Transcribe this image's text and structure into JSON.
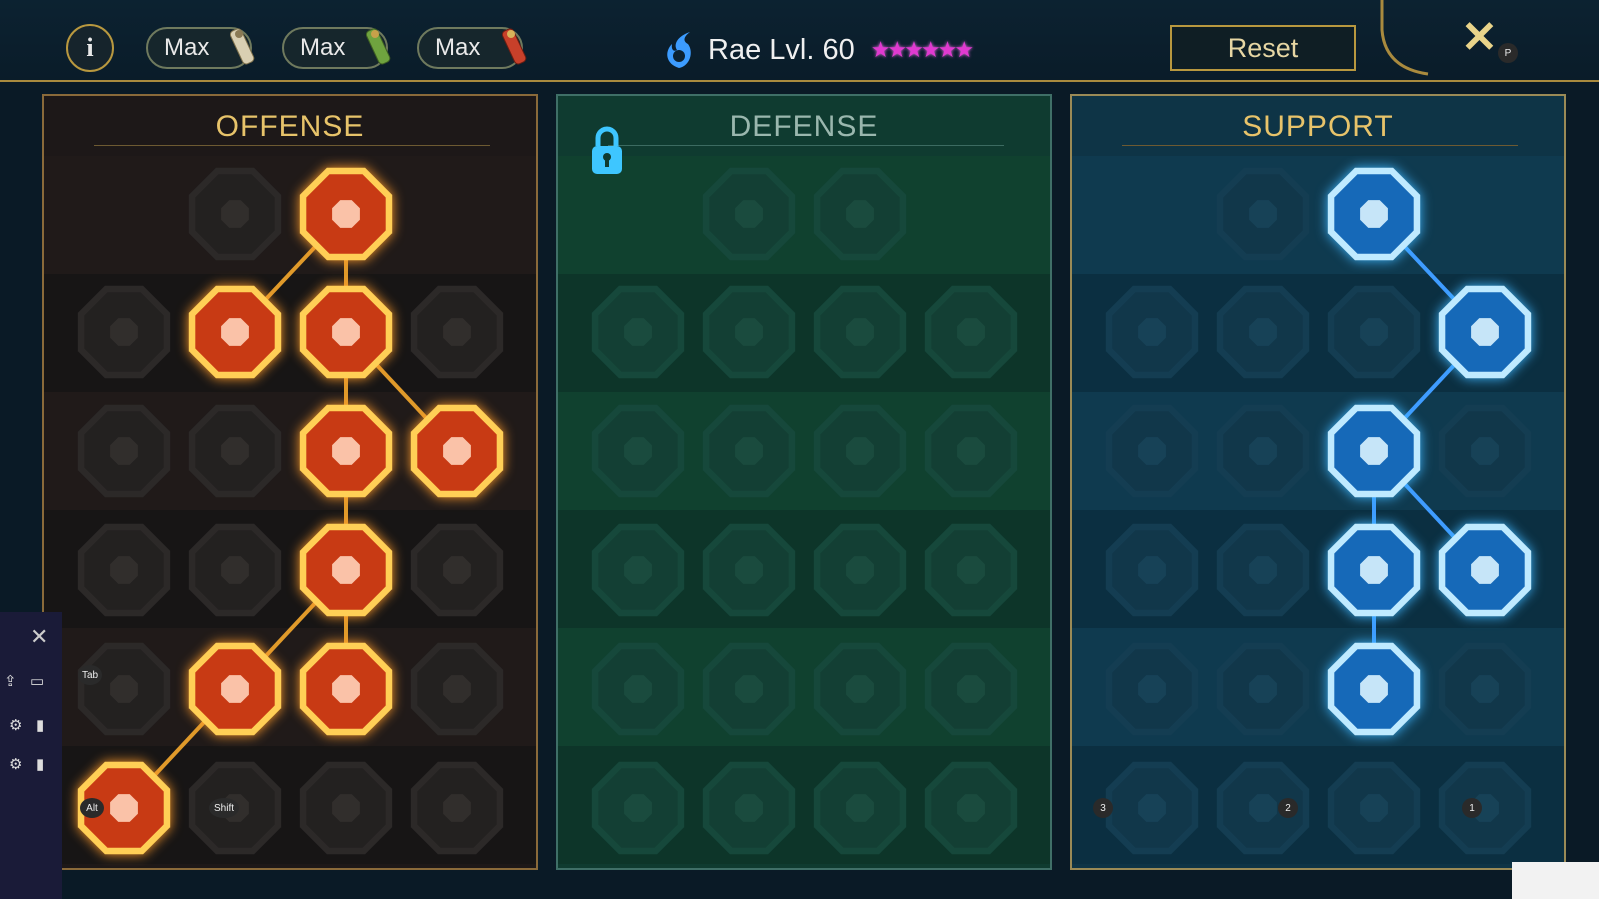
{
  "topbar": {
    "info_label": "i",
    "max_buttons": [
      "Max",
      "Max",
      "Max"
    ],
    "champion": "Rae Lvl. 60",
    "stars": "★★★★★★",
    "reset_label": "Reset",
    "close_label": "✕",
    "close_key": "P"
  },
  "panels": {
    "offense": {
      "title": "OFFENSE"
    },
    "defense": {
      "title": "DEFENSE",
      "locked": true
    },
    "support": {
      "title": "SUPPORT"
    }
  },
  "hotkeys": {
    "tab": "Tab",
    "alt": "Alt",
    "shift": "Shift",
    "s3": "3",
    "s2": "2",
    "s1": "1"
  },
  "colors": {
    "offense_active": "#ff6a2a",
    "support_active": "#3fb6ff",
    "gold": "#b8983f"
  },
  "offense_nodes": [
    {
      "row": 0,
      "col": 1,
      "icon": "crossed-swords-icon",
      "active": false
    },
    {
      "row": 0,
      "col": 2,
      "icon": "sword-strike-icon",
      "active": true
    },
    {
      "row": 1,
      "col": 0,
      "icon": "horned-heart-icon",
      "active": false
    },
    {
      "row": 1,
      "col": 1,
      "icon": "triple-arrow-icon",
      "active": true
    },
    {
      "row": 1,
      "col": 2,
      "icon": "shield-break-icon",
      "active": true
    },
    {
      "row": 1,
      "col": 3,
      "icon": "heart-icon",
      "active": false
    },
    {
      "row": 2,
      "col": 0,
      "icon": "fist-icon",
      "active": false
    },
    {
      "row": 2,
      "col": 1,
      "icon": "fangs-icon",
      "active": false
    },
    {
      "row": 2,
      "col": 2,
      "icon": "skull-slash-icon",
      "active": true
    },
    {
      "row": 2,
      "col": 3,
      "icon": "dagger-hand-icon",
      "active": true
    },
    {
      "row": 3,
      "col": 0,
      "icon": "heart-sword-icon",
      "active": false
    },
    {
      "row": 3,
      "col": 1,
      "icon": "gauntlet-icon",
      "active": false
    },
    {
      "row": 3,
      "col": 2,
      "icon": "axe-icon",
      "active": true
    },
    {
      "row": 3,
      "col": 3,
      "icon": "chain-bolt-icon",
      "active": false
    },
    {
      "row": 4,
      "col": 0,
      "icon": "helm-icon",
      "active": false
    },
    {
      "row": 4,
      "col": 1,
      "icon": "skulls-icon",
      "active": true
    },
    {
      "row": 4,
      "col": 2,
      "icon": "blade-circle-icon",
      "active": true
    },
    {
      "row": 4,
      "col": 3,
      "icon": "brute-icon",
      "active": false
    },
    {
      "row": 5,
      "col": 0,
      "icon": "sparkle-sword-icon",
      "active": true
    },
    {
      "row": 5,
      "col": 1,
      "icon": "knight-helm-icon",
      "active": false
    },
    {
      "row": 5,
      "col": 2,
      "icon": "demon-icon",
      "active": false
    },
    {
      "row": 5,
      "col": 3,
      "icon": "skull-crown-icon",
      "active": false
    }
  ],
  "defense_nodes": [
    {
      "row": 0,
      "col": 1,
      "icon": "armor-plates-icon",
      "active": false
    },
    {
      "row": 0,
      "col": 2,
      "icon": "raised-fist-icon",
      "active": false
    },
    {
      "row": 1,
      "col": 0,
      "icon": "shield-icon",
      "active": false
    },
    {
      "row": 1,
      "col": 1,
      "icon": "heart-shield-icon",
      "active": false
    },
    {
      "row": 1,
      "col": 2,
      "icon": "warrior-icon",
      "active": false
    },
    {
      "row": 1,
      "col": 3,
      "icon": "blades-icon",
      "active": false
    },
    {
      "row": 2,
      "col": 0,
      "icon": "dodge-icon",
      "active": false
    },
    {
      "row": 2,
      "col": 1,
      "icon": "knight-icon",
      "active": false
    },
    {
      "row": 2,
      "col": 2,
      "icon": "skull-heart-icon",
      "active": false
    },
    {
      "row": 2,
      "col": 3,
      "icon": "aura-icon",
      "active": false
    },
    {
      "row": 3,
      "col": 0,
      "icon": "giant-icon",
      "active": false
    },
    {
      "row": 3,
      "col": 1,
      "icon": "hourglass-icon",
      "active": false
    },
    {
      "row": 3,
      "col": 2,
      "icon": "hand-icon",
      "active": false
    },
    {
      "row": 3,
      "col": 3,
      "icon": "bull-icon",
      "active": false
    },
    {
      "row": 4,
      "col": 0,
      "icon": "runner-icon",
      "active": false
    },
    {
      "row": 4,
      "col": 1,
      "icon": "drops-icon",
      "active": false
    },
    {
      "row": 4,
      "col": 2,
      "icon": "skull-sun-icon",
      "active": false
    },
    {
      "row": 4,
      "col": 3,
      "icon": "swirl-icon",
      "active": false
    },
    {
      "row": 5,
      "col": 0,
      "icon": "crowned-warrior-icon",
      "active": false
    },
    {
      "row": 5,
      "col": 1,
      "icon": "winged-shield-icon",
      "active": false
    },
    {
      "row": 5,
      "col": 2,
      "icon": "skull-wings-icon",
      "active": false
    },
    {
      "row": 5,
      "col": 3,
      "icon": "strongman-icon",
      "active": false
    }
  ],
  "support_nodes": [
    {
      "row": 0,
      "col": 1,
      "icon": "heart-plus-icon",
      "active": false
    },
    {
      "row": 0,
      "col": 2,
      "icon": "spiral-strike-icon",
      "active": true
    },
    {
      "row": 1,
      "col": 0,
      "icon": "praying-hands-icon",
      "active": false
    },
    {
      "row": 1,
      "col": 1,
      "icon": "ward-icon",
      "active": false
    },
    {
      "row": 1,
      "col": 2,
      "icon": "skull-flame-icon",
      "active": false
    },
    {
      "row": 1,
      "col": 3,
      "icon": "wind-hand-icon",
      "active": true
    },
    {
      "row": 2,
      "col": 0,
      "icon": "figure-sparkle-icon",
      "active": false
    },
    {
      "row": 2,
      "col": 1,
      "icon": "bolt-shield-icon",
      "active": false
    },
    {
      "row": 2,
      "col": 2,
      "icon": "lightning-icon",
      "active": true
    },
    {
      "row": 2,
      "col": 3,
      "icon": "silhouette-icon",
      "active": false
    },
    {
      "row": 3,
      "col": 0,
      "icon": "chained-heart-icon",
      "active": false
    },
    {
      "row": 3,
      "col": 1,
      "icon": "comet-icon",
      "active": false
    },
    {
      "row": 3,
      "col": 2,
      "icon": "book-icon",
      "active": true
    },
    {
      "row": 3,
      "col": 3,
      "icon": "angry-eyes-icon",
      "active": true
    },
    {
      "row": 4,
      "col": 0,
      "icon": "compass-star-icon",
      "active": false
    },
    {
      "row": 4,
      "col": 1,
      "icon": "boot-icon",
      "active": false
    },
    {
      "row": 4,
      "col": 2,
      "icon": "eye-icon",
      "active": true
    },
    {
      "row": 4,
      "col": 3,
      "icon": "dancer-icon",
      "active": false
    },
    {
      "row": 5,
      "col": 0,
      "icon": "potion-icon",
      "active": false
    },
    {
      "row": 5,
      "col": 1,
      "icon": "skull-shards-icon",
      "active": false
    },
    {
      "row": 5,
      "col": 2,
      "icon": "fist-burst-icon",
      "active": false
    },
    {
      "row": 5,
      "col": 3,
      "icon": "eagle-icon",
      "active": false
    }
  ],
  "offense_links": [
    [
      0,
      2,
      1,
      1
    ],
    [
      0,
      2,
      1,
      2
    ],
    [
      1,
      2,
      2,
      2
    ],
    [
      1,
      2,
      2,
      3
    ],
    [
      2,
      2,
      3,
      2
    ],
    [
      3,
      2,
      4,
      1
    ],
    [
      3,
      2,
      4,
      2
    ],
    [
      4,
      1,
      5,
      0
    ]
  ],
  "support_links": [
    [
      0,
      2,
      1,
      3
    ],
    [
      1,
      3,
      2,
      2
    ],
    [
      2,
      2,
      3,
      2
    ],
    [
      2,
      2,
      3,
      3
    ],
    [
      3,
      2,
      4,
      2
    ]
  ]
}
